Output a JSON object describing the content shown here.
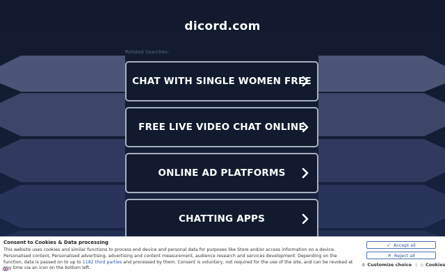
{
  "site": {
    "domain": "dicord.com",
    "related_label": "Related Searches:"
  },
  "links": [
    {
      "label": "CHAT WITH SINGLE WOMEN FREE",
      "icon": "chevron-right-icon"
    },
    {
      "label": "FREE LIVE VIDEO CHAT ONLINE",
      "icon": "chevron-right-icon"
    },
    {
      "label": "ONLINE AD PLATFORMS",
      "icon": "chevron-right-icon"
    },
    {
      "label": "CHATTING APPS",
      "icon": "chevron-right-icon"
    }
  ],
  "consent": {
    "title": "Consent to Cookies & Data processing",
    "body_pre": "This website uses cookies and similar functions to process end device and personal data for purposes like Store and/or access information on a device, Personalised content, Personalised advertising, advertising and content measurement, audience research and services development. Depending on the function, data is passed on to up to ",
    "body_link": "1182 third parties",
    "body_post": " and processed by them. Consent is voluntary, not required for the use of the site, and can be revoked at any time via an icon on the bottom left.",
    "accept_label": "Accept all",
    "reject_label": "Reject all",
    "customize_label": "Customize choice",
    "cookies_label": "Cookies",
    "separator": "|"
  },
  "colors": {
    "background": "#111a2e",
    "card_border": "#a9b1c0",
    "button_text": "#2c54a0"
  }
}
